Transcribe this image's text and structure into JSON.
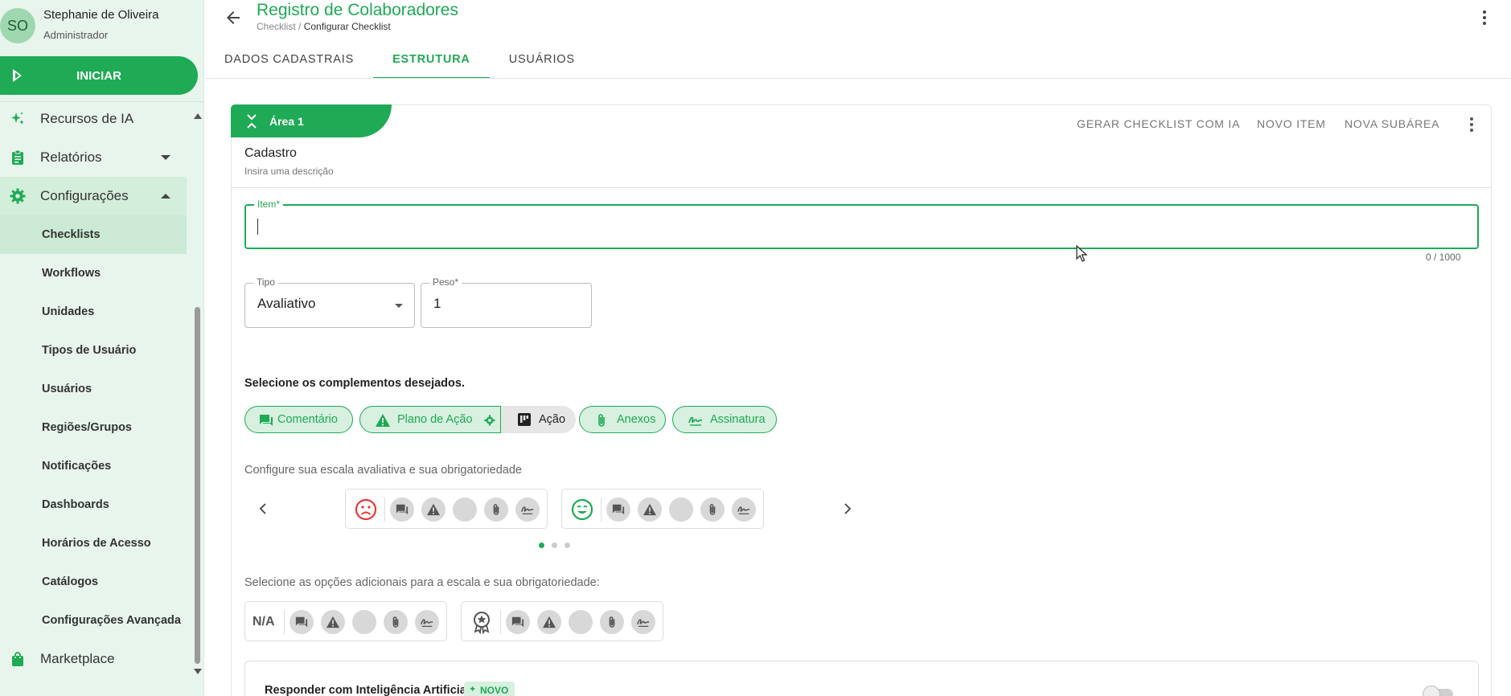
{
  "user": {
    "initials": "SO",
    "name": "Stephanie de Oliveira",
    "role": "Administrador"
  },
  "start_button": {
    "label": "INICIAR"
  },
  "sidebar": {
    "items": [
      {
        "label": "Recursos de IA",
        "icon": "sparkles-icon"
      },
      {
        "label": "Relatórios",
        "icon": "clipboard-icon"
      },
      {
        "label": "Configurações",
        "icon": "gear-icon"
      }
    ],
    "config_sub": [
      "Checklists",
      "Workflows",
      "Unidades",
      "Tipos de Usuário",
      "Usuários",
      "Regiões/Grupos",
      "Notificações",
      "Dashboards",
      "Horários de Acesso",
      "Catálogos",
      "Configurações Avançada"
    ],
    "marketplace": {
      "label": "Marketplace",
      "icon": "shopping-bag-icon"
    }
  },
  "header": {
    "title": "Registro de Colaboradores",
    "breadcrumb_root": "Checklist",
    "breadcrumb_sep": " / ",
    "breadcrumb_current": "Configurar Checklist"
  },
  "tabs": [
    "DADOS CADASTRAIS",
    "ESTRUTURA",
    "USUÁRIOS"
  ],
  "area": {
    "label": "Área 1",
    "actions": {
      "ai": "GERAR CHECKLIST COM IA",
      "new_item": "NOVO ITEM",
      "new_subarea": "NOVA SUBÁREA"
    },
    "title": "Cadastro",
    "description": "Insira uma descrição"
  },
  "item_field": {
    "label": "Item*",
    "value": "",
    "counter": "0 / 1000"
  },
  "type_field": {
    "label": "Tipo",
    "value": "Avaliativo"
  },
  "weight_field": {
    "label": "Peso*",
    "value": "1"
  },
  "complements": {
    "heading": "Selecione os complementos desejados.",
    "chips": [
      "Comentário",
      "Plano de Ação",
      "Ação",
      "Anexos",
      "Assinatura"
    ]
  },
  "scale": {
    "heading": "Configure sua escala avaliativa e sua obrigatoriedade",
    "page": 1,
    "pages": 3
  },
  "additional": {
    "heading": "Selecione as opções adicionais para a escala e sua obrigatoriedade:",
    "na_label": "N/A"
  },
  "ai_answer": {
    "title": "Responder com Inteligência Artificial",
    "badge": "NOVO",
    "enabled": false
  },
  "colors": {
    "primary": "#1faa55",
    "primary_light": "#d7f0df",
    "sidebar_bg": "#e8f5ec",
    "sad": "#e53935"
  }
}
